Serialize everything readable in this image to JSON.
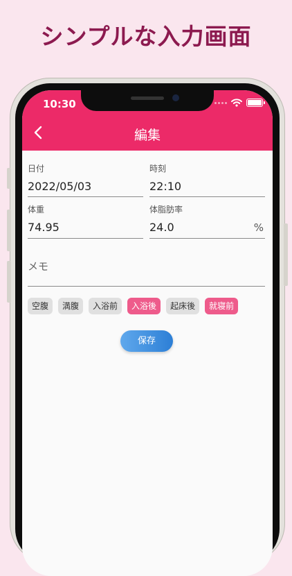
{
  "headline": "シンプルな入力画面",
  "status_bar": {
    "time": "10:30"
  },
  "app_bar": {
    "title": "編集",
    "back_icon": "chevron-left-icon"
  },
  "form": {
    "date": {
      "label": "日付",
      "value": "2022/05/03"
    },
    "time": {
      "label": "時刻",
      "value": "22:10"
    },
    "weight": {
      "label": "体重",
      "value": "74.95"
    },
    "body_fat": {
      "label": "体脂肪率",
      "value": "24.0",
      "suffix": "%"
    },
    "memo": {
      "placeholder": "メモ"
    }
  },
  "tags": [
    {
      "label": "空腹",
      "selected": false
    },
    {
      "label": "満腹",
      "selected": false
    },
    {
      "label": "入浴前",
      "selected": false
    },
    {
      "label": "入浴後",
      "selected": true
    },
    {
      "label": "起床後",
      "selected": false
    },
    {
      "label": "就寝前",
      "selected": true
    }
  ],
  "save_label": "保存",
  "colors": {
    "accent": "#ec2a68",
    "chip_selected": "#ee5b8b",
    "button": "#3b8de0",
    "background": "#fae6ee"
  }
}
